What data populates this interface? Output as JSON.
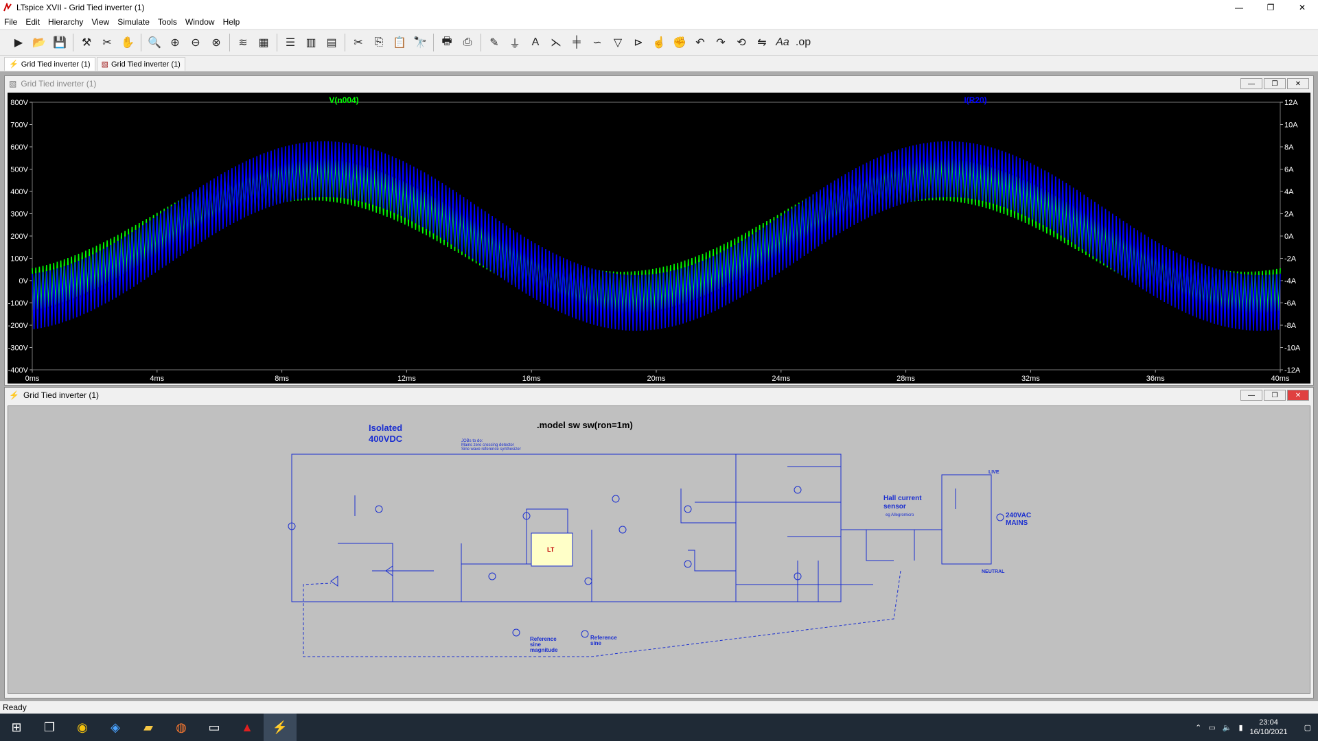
{
  "window": {
    "title": "LTspice XVII - Grid Tied inverter (1)",
    "minimize": "—",
    "maximize": "❐",
    "close": "✕"
  },
  "menu": [
    "File",
    "Edit",
    "Hierarchy",
    "View",
    "Simulate",
    "Tools",
    "Window",
    "Help"
  ],
  "toolbar_icons": [
    "run-icon",
    "open-icon",
    "save-icon",
    "control-panel-icon",
    "halt-icon",
    "pan-icon",
    "zoom-in-icon",
    "zoom-fit-icon",
    "zoom-out-icon",
    "zoom-cancel-icon",
    "autorange-icon",
    "mark-icon",
    "tile-horizontal-icon",
    "tile-vertical-icon",
    "cascade-icon",
    "cut-icon",
    "copy-icon",
    "paste-icon",
    "find-icon",
    "print-icon",
    "print-preview-icon",
    "wire-icon",
    "ground-icon",
    "label-icon",
    "resistor-icon",
    "capacitor-icon",
    "inductor-icon",
    "diode-icon",
    "component-icon",
    "move-icon",
    "drag-icon",
    "undo-icon",
    "redo-icon",
    "rotate-icon",
    "mirror-icon",
    "text-icon",
    "spice-directive-icon"
  ],
  "tabs": [
    {
      "label": "Grid Tied inverter (1)",
      "icon": "schematic-icon"
    },
    {
      "label": "Grid Tied inverter (1)",
      "icon": "waveform-icon"
    }
  ],
  "plot_pane": {
    "title": "Grid Tied inverter (1)",
    "trace_green": "V(n004)",
    "trace_blue": "I(R20)"
  },
  "schematic_pane": {
    "title": "Grid Tied inverter (1)",
    "labels": {
      "isolated": "Isolated",
      "vdc": "400VDC",
      "model": ".model sw sw(ron=1m)",
      "jobs": "JOBs to do:",
      "job1": "Mains zero crossing detector",
      "job2": "Sine wave reference synthesizer",
      "hall1": "Hall current",
      "hall2": "sensor",
      "hall3": "eg Allegromicro",
      "mains1": "240VAC",
      "mains2": "MAINS",
      "live": "LIVE",
      "neutral": "NEUTRAL",
      "ref_mag1": "Reference",
      "ref_mag2": "sine",
      "ref_mag3": "magnitude",
      "ref_sine1": "Reference",
      "ref_sine2": "sine"
    }
  },
  "status": "Ready",
  "tray": {
    "time": "23:04",
    "date": "16/10/2021"
  },
  "chart_data": {
    "type": "line",
    "title": "",
    "xlabel": "",
    "ylabel_left": "",
    "ylabel_right": "",
    "x_ticks": [
      "0ms",
      "4ms",
      "8ms",
      "12ms",
      "16ms",
      "20ms",
      "24ms",
      "28ms",
      "32ms",
      "36ms",
      "40ms"
    ],
    "xlim": [
      0,
      40
    ],
    "y_left_ticks": [
      "800V",
      "700V",
      "600V",
      "500V",
      "400V",
      "300V",
      "200V",
      "100V",
      "0V",
      "-100V",
      "-200V",
      "-300V",
      "-400V"
    ],
    "ylim_left": [
      -400,
      800
    ],
    "y_right_ticks": [
      "12A",
      "10A",
      "8A",
      "6A",
      "4A",
      "2A",
      "0A",
      "-2A",
      "-4A",
      "-6A",
      "-8A",
      "-10A",
      "-12A"
    ],
    "ylim_right": [
      -12,
      12
    ],
    "grid": false,
    "legend": "top",
    "series": [
      {
        "name": "V(n004)",
        "color": "#00ff00",
        "axis": "left",
        "offset": 200,
        "amp_hi": 445,
        "amp_lo": 255,
        "freq_ms": 20
      },
      {
        "name": "I(R20)",
        "color": "#0000ff",
        "axis": "right",
        "offset": 0,
        "amp_hi": 11,
        "amp_lo": 6,
        "freq_ms": 20
      }
    ]
  }
}
